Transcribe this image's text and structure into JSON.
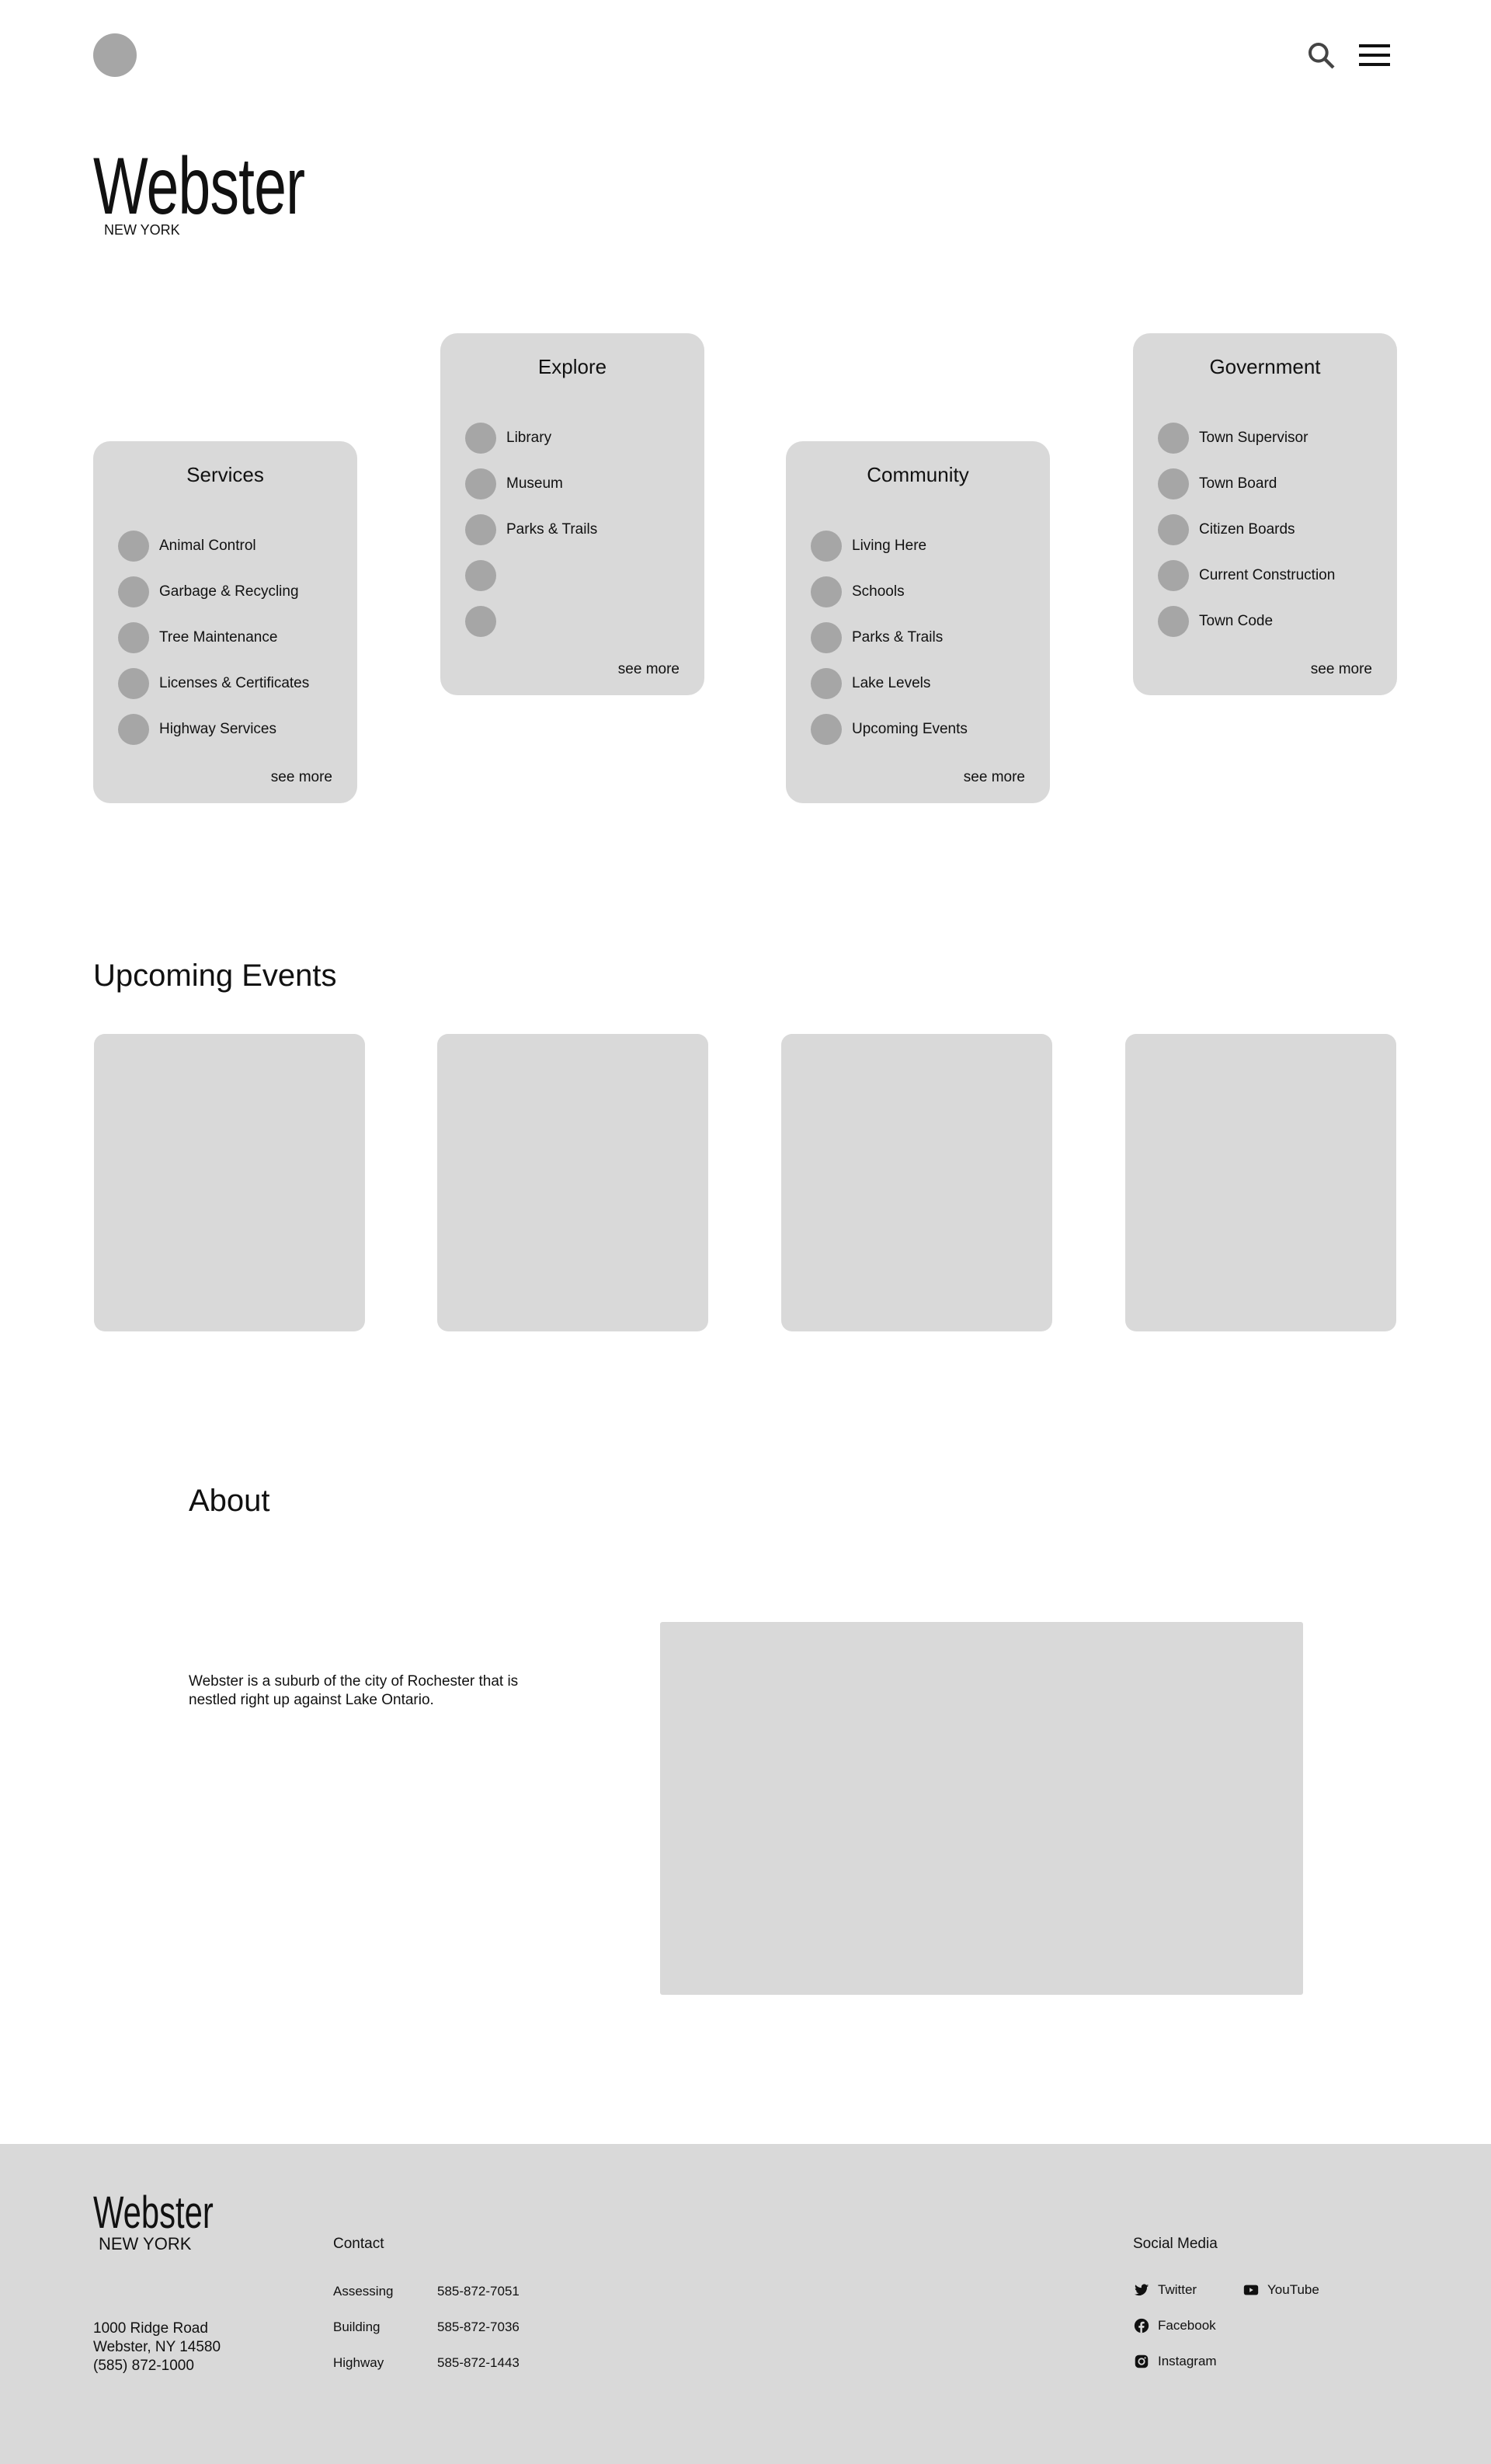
{
  "header": {
    "brand": "Webster",
    "brand_sub": "NEW YORK"
  },
  "cards": [
    {
      "title": "Services",
      "items": [
        "Animal Control",
        "Garbage & Recycling",
        "Tree Maintenance",
        "Licenses & Certificates",
        "Highway Services"
      ],
      "see_more": "see more"
    },
    {
      "title": "Explore",
      "items": [
        "Library",
        "Museum",
        "Parks & Trails",
        "",
        ""
      ],
      "see_more": "see more"
    },
    {
      "title": "Community",
      "items": [
        "Living Here",
        "Schools",
        "Parks & Trails",
        "Lake Levels",
        "Upcoming Events"
      ],
      "see_more": "see more"
    },
    {
      "title": "Government",
      "items": [
        "Town Supervisor",
        "Town Board",
        "Citizen Boards",
        "Current Construction",
        "Town Code"
      ],
      "see_more": "see more"
    }
  ],
  "events": {
    "heading": "Upcoming Events"
  },
  "about": {
    "heading": "About",
    "text": "Webster is a suburb of the city of Rochester that is nestled right up against Lake Ontario."
  },
  "footer": {
    "brand": "Webster",
    "brand_sub": "NEW YORK",
    "address": [
      "1000 Ridge Road",
      "Webster, NY 14580",
      "(585) 872-1000"
    ],
    "contact_heading": "Contact",
    "contacts": [
      {
        "label": "Assessing",
        "phone": "585-872-7051"
      },
      {
        "label": "Building",
        "phone": "585-872-7036"
      },
      {
        "label": "Highway",
        "phone": "585-872-1443"
      }
    ],
    "social_heading": "Social Media",
    "social": {
      "twitter": "Twitter",
      "youtube": "YouTube",
      "facebook": "Facebook",
      "instagram": "Instagram"
    }
  }
}
